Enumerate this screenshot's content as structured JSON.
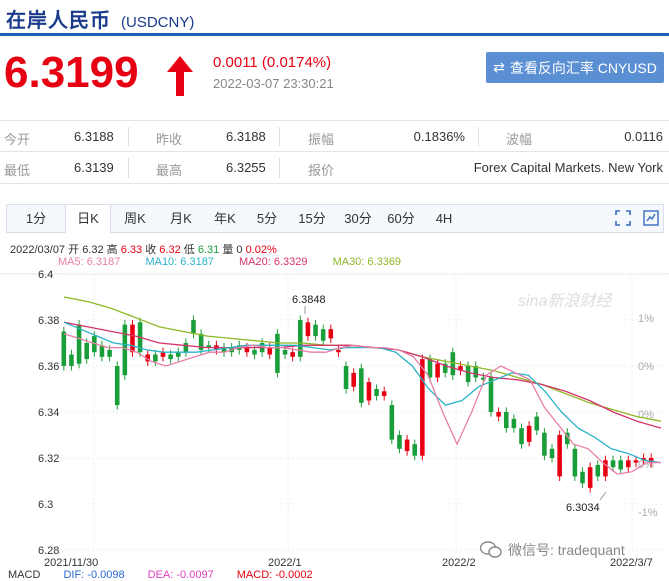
{
  "header": {
    "title": "在岸人民币",
    "code": "(USDCNY)"
  },
  "quote": {
    "price": "6.3199",
    "change": "0.0011 (0.0174%)",
    "timestamp": "2022-03-07 23:30:21",
    "direction": "up",
    "up_color": "#e60012"
  },
  "reverse_button": {
    "label": "查看反向汇率 CNYUSD",
    "icon": "swap-icon"
  },
  "stats": {
    "open_label": "今开",
    "open": "6.3188",
    "prev_close_label": "昨收",
    "prev_close": "6.3188",
    "amplitude_label": "振幅",
    "amplitude": "0.1836%",
    "range_label": "波幅",
    "range": "0.0116",
    "low_label": "最低",
    "low": "6.3139",
    "high_label": "最高",
    "high": "6.3255",
    "quote_label": "报价",
    "quote_source": "Forex Capital Markets. New York"
  },
  "tabs": [
    {
      "label": "1分",
      "active": false
    },
    {
      "label": "日K",
      "active": true
    },
    {
      "label": "周K",
      "active": false
    },
    {
      "label": "月K",
      "active": false
    },
    {
      "label": "年K",
      "active": false
    },
    {
      "label": "5分",
      "active": false
    },
    {
      "label": "15分",
      "active": false
    },
    {
      "label": "30分",
      "active": false
    },
    {
      "label": "60分",
      "active": false
    },
    {
      "label": "4H",
      "active": false
    }
  ],
  "ohlc": {
    "date": "2022/03/07",
    "open_label": "开",
    "open": "6.32",
    "high_label": "高",
    "high": "6.33",
    "close_label": "收",
    "close": "6.32",
    "low_label": "低",
    "low": "6.31",
    "volume_label": "量",
    "volume": "0",
    "change": "0.02%"
  },
  "ma": {
    "ma5": "MA5: 6.3187",
    "ma10": "MA10: 6.3187",
    "ma20": "MA20: 6.3329",
    "ma30": "MA30: 6.3369",
    "ma5_color": "#e87fa8",
    "ma10_color": "#2ab4c8",
    "ma20_color": "#d6336c",
    "ma30_color": "#8fb826"
  },
  "macd": {
    "label": "MACD",
    "dif": "DIF: -0.0098",
    "dea": "DEA: -0.0097",
    "macd": "MACD: -0.0002"
  },
  "watermark": {
    "sina": "sina新浪财经",
    "wechat": "微信号: tradequant"
  },
  "chart_data": {
    "type": "candlestick",
    "y_ticks": [
      "6.4",
      "6.38",
      "6.36",
      "6.34",
      "6.32",
      "6.3",
      "6.28"
    ],
    "y_tick_values": [
      6.4,
      6.38,
      6.36,
      6.34,
      6.32,
      6.3,
      6.28
    ],
    "ylim": [
      6.28,
      6.4
    ],
    "right_ticks": [
      "1%",
      "0%",
      "0%",
      "0%",
      "-1%"
    ],
    "x_ticks": [
      "2021/11/30",
      "2022/1",
      "2022/2",
      "2022/3/7"
    ],
    "annotations": {
      "max": "6.3848",
      "min": "6.3034"
    },
    "candles": [
      [
        6.375,
        6.36
      ],
      [
        6.365,
        6.36
      ],
      [
        6.378,
        6.361
      ],
      [
        6.37,
        6.363
      ],
      [
        6.373,
        6.366
      ],
      [
        6.369,
        6.364
      ],
      [
        6.367,
        6.364
      ],
      [
        6.36,
        6.343
      ],
      [
        6.378,
        6.356
      ],
      [
        6.366,
        6.378
      ],
      [
        6.379,
        6.366
      ],
      [
        6.362,
        6.365
      ],
      [
        6.365,
        6.362
      ],
      [
        6.364,
        6.366
      ],
      [
        6.365,
        6.363
      ],
      [
        6.366,
        6.364
      ],
      [
        6.37,
        6.366
      ],
      [
        6.38,
        6.374
      ],
      [
        6.374,
        6.367
      ],
      [
        6.369,
        6.368
      ],
      [
        6.367,
        6.369
      ],
      [
        6.368,
        6.366
      ],
      [
        6.368,
        6.366
      ],
      [
        6.369,
        6.367
      ],
      [
        6.366,
        6.368
      ],
      [
        6.367,
        6.365
      ],
      [
        6.37,
        6.366
      ],
      [
        6.365,
        6.368
      ],
      [
        6.374,
        6.357
      ],
      [
        6.367,
        6.365
      ],
      [
        6.364,
        6.366
      ],
      [
        6.38,
        6.364
      ],
      [
        6.373,
        6.379
      ],
      [
        6.378,
        6.373
      ],
      [
        6.376,
        6.371
      ],
      [
        6.372,
        6.376
      ],
      [
        6.366,
        6.367
      ],
      [
        6.36,
        6.35
      ],
      [
        6.351,
        6.357
      ],
      [
        6.359,
        6.344
      ],
      [
        6.345,
        6.353
      ],
      [
        6.35,
        6.347
      ],
      [
        6.347,
        6.349
      ],
      [
        6.343,
        6.328
      ],
      [
        6.33,
        6.324
      ],
      [
        6.323,
        6.328
      ],
      [
        6.326,
        6.321
      ],
      [
        6.321,
        6.363
      ],
      [
        6.363,
        6.355
      ],
      [
        6.355,
        6.361
      ],
      [
        6.361,
        6.357
      ],
      [
        6.366,
        6.356
      ],
      [
        6.358,
        6.36
      ],
      [
        6.36,
        6.353
      ],
      [
        6.36,
        6.355
      ],
      [
        6.355,
        6.354
      ],
      [
        6.355,
        6.34
      ],
      [
        6.338,
        6.34
      ],
      [
        6.34,
        6.333
      ],
      [
        6.337,
        6.333
      ],
      [
        6.333,
        6.326
      ],
      [
        6.327,
        6.334
      ],
      [
        6.338,
        6.332
      ],
      [
        6.331,
        6.321
      ],
      [
        6.324,
        6.32
      ],
      [
        6.312,
        6.33
      ],
      [
        6.331,
        6.326
      ],
      [
        6.324,
        6.312
      ],
      [
        6.314,
        6.309
      ],
      [
        6.307,
        6.316
      ],
      [
        6.317,
        6.312
      ],
      [
        6.312,
        6.319
      ],
      [
        6.319,
        6.316
      ],
      [
        6.319,
        6.315
      ],
      [
        6.316,
        6.319
      ],
      [
        6.318,
        6.319
      ],
      [
        6.319,
        6.32
      ],
      [
        6.318,
        6.32
      ]
    ],
    "ma5": [
      6.374,
      6.372,
      6.37,
      6.368,
      6.368,
      6.366,
      6.362,
      6.36,
      6.362,
      6.364,
      6.366,
      6.366,
      6.368,
      6.369,
      6.368,
      6.368,
      6.367,
      6.366,
      6.366,
      6.368,
      6.369,
      6.368,
      6.368,
      6.367,
      6.364,
      6.356,
      6.34,
      6.326,
      6.34,
      6.356,
      6.36,
      6.357,
      6.354,
      6.342,
      6.334,
      6.326,
      6.324,
      6.318,
      6.313,
      6.314,
      6.318,
      6.318
    ],
    "ma10": [
      6.379,
      6.376,
      6.373,
      6.37,
      6.369,
      6.367,
      6.366,
      6.366,
      6.366,
      6.367,
      6.368,
      6.369,
      6.369,
      6.369,
      6.369,
      6.368,
      6.367,
      6.368,
      6.368,
      6.368,
      6.366,
      6.36,
      6.35,
      6.343,
      6.345,
      6.351,
      6.354,
      6.357,
      6.356,
      6.349,
      6.34,
      6.333,
      6.329,
      6.324,
      6.322,
      6.319,
      6.318
    ],
    "ma20": [
      6.379,
      6.377,
      6.375,
      6.373,
      6.37,
      6.369,
      6.368,
      6.368,
      6.368,
      6.368,
      6.369,
      6.369,
      6.369,
      6.368,
      6.367,
      6.364,
      6.36,
      6.357,
      6.355,
      6.354,
      6.352,
      6.349,
      6.345,
      6.34,
      6.336,
      6.333
    ],
    "ma30": [
      6.39,
      6.388,
      6.385,
      6.381,
      6.377,
      6.375,
      6.373,
      6.372,
      6.371,
      6.37,
      6.37,
      6.369,
      6.369,
      6.368,
      6.367,
      6.364,
      6.362,
      6.36,
      6.358,
      6.355,
      6.352,
      6.348,
      6.344,
      6.341,
      6.338,
      6.336
    ],
    "grid": true
  }
}
